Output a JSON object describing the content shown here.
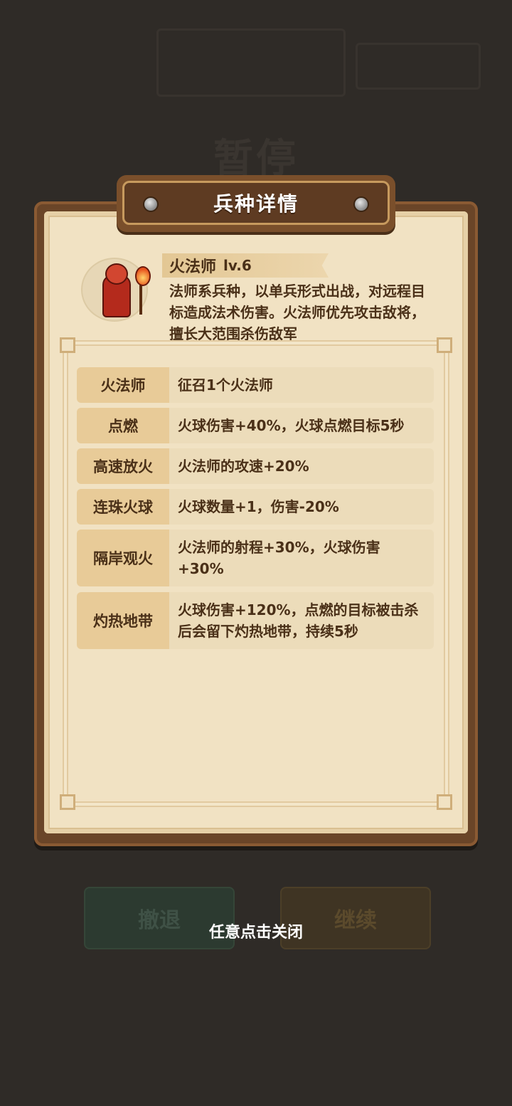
{
  "background": {
    "title": "暂停",
    "retreat_label": "撤退",
    "continue_label": "继续"
  },
  "panel": {
    "title": "兵种详情"
  },
  "unit": {
    "name": "火法师",
    "level": "lv.6",
    "description": "法师系兵种，以单兵形式出战，对远程目标造成法术伤害。火法师优先攻击敌将，擅长大范围杀伤敌军"
  },
  "skills": [
    {
      "name": "火法师",
      "effect": "征召1个火法师"
    },
    {
      "name": "点燃",
      "effect": "火球伤害+40%，火球点燃目标5秒"
    },
    {
      "name": "高速放火",
      "effect": "火法师的攻速+20%"
    },
    {
      "name": "连珠火球",
      "effect": "火球数量+1，伤害-20%"
    },
    {
      "name": "隔岸观火",
      "effect": "火法师的射程+30%，火球伤害+30%"
    },
    {
      "name": "灼热地带",
      "effect": "火球伤害+120%，点燃的目标被击杀后会留下灼热地带，持续5秒"
    }
  ],
  "close_hint": "任意点击关闭",
  "icons": {
    "portrait": "fire-mage-portrait-icon",
    "rivet": "rivet-icon"
  }
}
